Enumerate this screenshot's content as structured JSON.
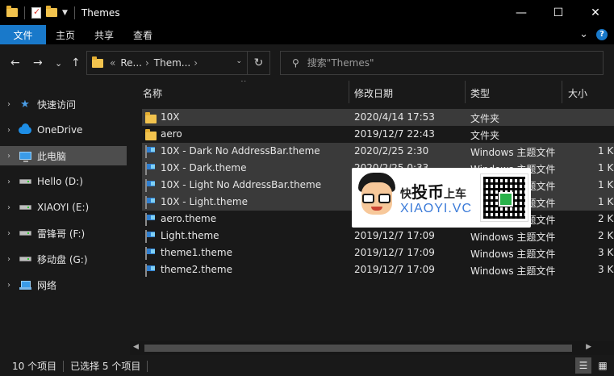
{
  "window": {
    "title": "Themes",
    "minimize": "—",
    "maximize": "☐",
    "close": "✕"
  },
  "ribbon": {
    "tabs": [
      {
        "label": "文件"
      },
      {
        "label": "主页"
      },
      {
        "label": "共享"
      },
      {
        "label": "查看"
      }
    ],
    "collapse": "⌄",
    "help": "?"
  },
  "nav": {
    "back": "←",
    "forward": "→",
    "recent": "⌄",
    "up": "↑",
    "breadcrumb": {
      "overflow": "«",
      "parts": [
        "Re...",
        "Them..."
      ],
      "separator": "›"
    },
    "refresh": "↻",
    "search_placeholder": "搜索\"Themes\""
  },
  "sidebar": {
    "items": [
      {
        "label": "快速访问",
        "icon": "star-icon"
      },
      {
        "label": "OneDrive",
        "icon": "cloud-icon"
      },
      {
        "label": "此电脑",
        "icon": "computer-icon",
        "selected": true
      },
      {
        "label": "Hello (D:)",
        "icon": "drive-icon"
      },
      {
        "label": "XIAOYI (E:)",
        "icon": "drive-icon"
      },
      {
        "label": "雷锋哥 (F:)",
        "icon": "drive-icon"
      },
      {
        "label": "移动盘 (G:)",
        "icon": "drive-icon"
      },
      {
        "label": "网络",
        "icon": "network-icon"
      }
    ]
  },
  "columns": [
    "名称",
    "修改日期",
    "类型",
    "大小"
  ],
  "files": [
    {
      "name": "10X",
      "date": "2020/4/14 17:53",
      "type": "文件夹",
      "size": "",
      "kind": "folder",
      "selected": true
    },
    {
      "name": "aero",
      "date": "2019/12/7 22:43",
      "type": "文件夹",
      "size": "",
      "kind": "folder",
      "selected": false
    },
    {
      "name": "10X - Dark No AddressBar.theme",
      "date": "2020/2/25 2:30",
      "type": "Windows 主题文件",
      "size": "1 K",
      "kind": "theme",
      "selected": true
    },
    {
      "name": "10X - Dark.theme",
      "date": "2020/2/25 0:33",
      "type": "Windows 主题文件",
      "size": "1 K",
      "kind": "theme",
      "selected": true
    },
    {
      "name": "10X - Light No AddressBar.theme",
      "date": "",
      "type": "Windows 主题文件",
      "size": "1 K",
      "kind": "theme",
      "selected": true
    },
    {
      "name": "10X - Light.theme",
      "date": "",
      "type": "Windows 主题文件",
      "size": "1 K",
      "kind": "theme",
      "selected": true
    },
    {
      "name": "aero.theme",
      "date": "",
      "type": "Windows 主题文件",
      "size": "2 K",
      "kind": "theme",
      "selected": false
    },
    {
      "name": "Light.theme",
      "date": "2019/12/7 17:09",
      "type": "Windows 主题文件",
      "size": "2 K",
      "kind": "theme",
      "selected": false
    },
    {
      "name": "theme1.theme",
      "date": "2019/12/7 17:09",
      "type": "Windows 主题文件",
      "size": "3 K",
      "kind": "theme",
      "selected": false
    },
    {
      "name": "theme2.theme",
      "date": "2019/12/7 17:09",
      "type": "Windows 主题文件",
      "size": "3 K",
      "kind": "theme",
      "selected": false
    }
  ],
  "watermark": {
    "brand_a": "快",
    "brand_b": "投币",
    "brand_c": "上车",
    "site": "XIAOYI.VC"
  },
  "status": {
    "count": "10 个项目",
    "selected": "已选择 5 个项目"
  },
  "colors": {
    "accent": "#1979ca",
    "background": "#191919",
    "selection": "#3a3a3a",
    "folder": "#f2c34e"
  }
}
